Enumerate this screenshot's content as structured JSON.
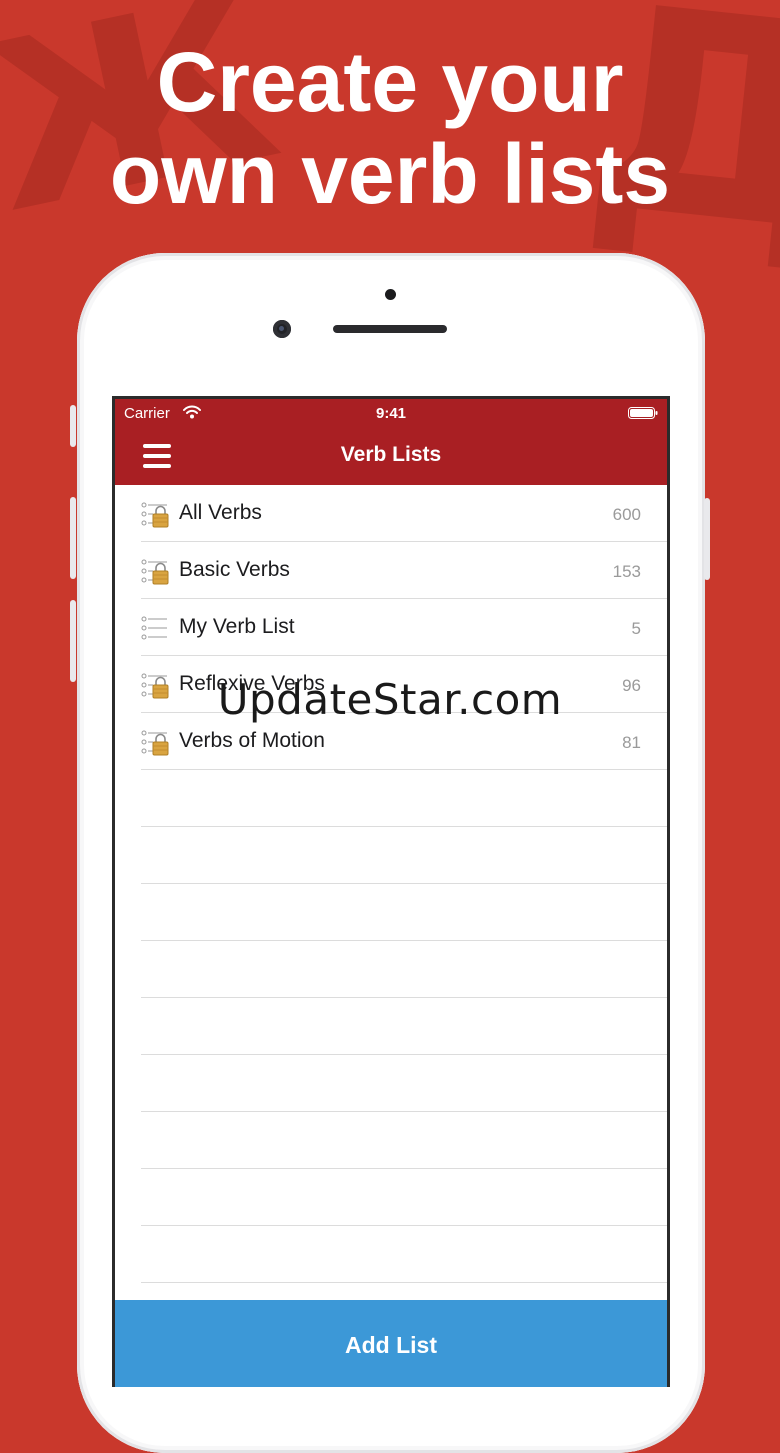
{
  "headline": {
    "line1": "Create your",
    "line2": "own verb lists"
  },
  "status_bar": {
    "carrier": "Carrier",
    "time": "9:41"
  },
  "nav": {
    "title": "Verb Lists"
  },
  "lists": [
    {
      "label": "All Verbs",
      "count": "600",
      "icon": "locked-list-icon"
    },
    {
      "label": "Basic Verbs",
      "count": "153",
      "icon": "locked-list-icon"
    },
    {
      "label": "My Verb List",
      "count": "5",
      "icon": "list-icon"
    },
    {
      "label": "Reflexive Verbs",
      "count": "96",
      "icon": "locked-list-icon"
    },
    {
      "label": "Verbs of Motion",
      "count": "81",
      "icon": "locked-list-icon"
    }
  ],
  "add_button": {
    "label": "Add List"
  },
  "watermark": "UpdateStar.com",
  "background_glyphs": [
    "Ж",
    "Д"
  ],
  "colors": {
    "background": "#c9382c",
    "navbar": "#a91f23",
    "add_button": "#3c98d7",
    "lock": "#d9a441"
  }
}
